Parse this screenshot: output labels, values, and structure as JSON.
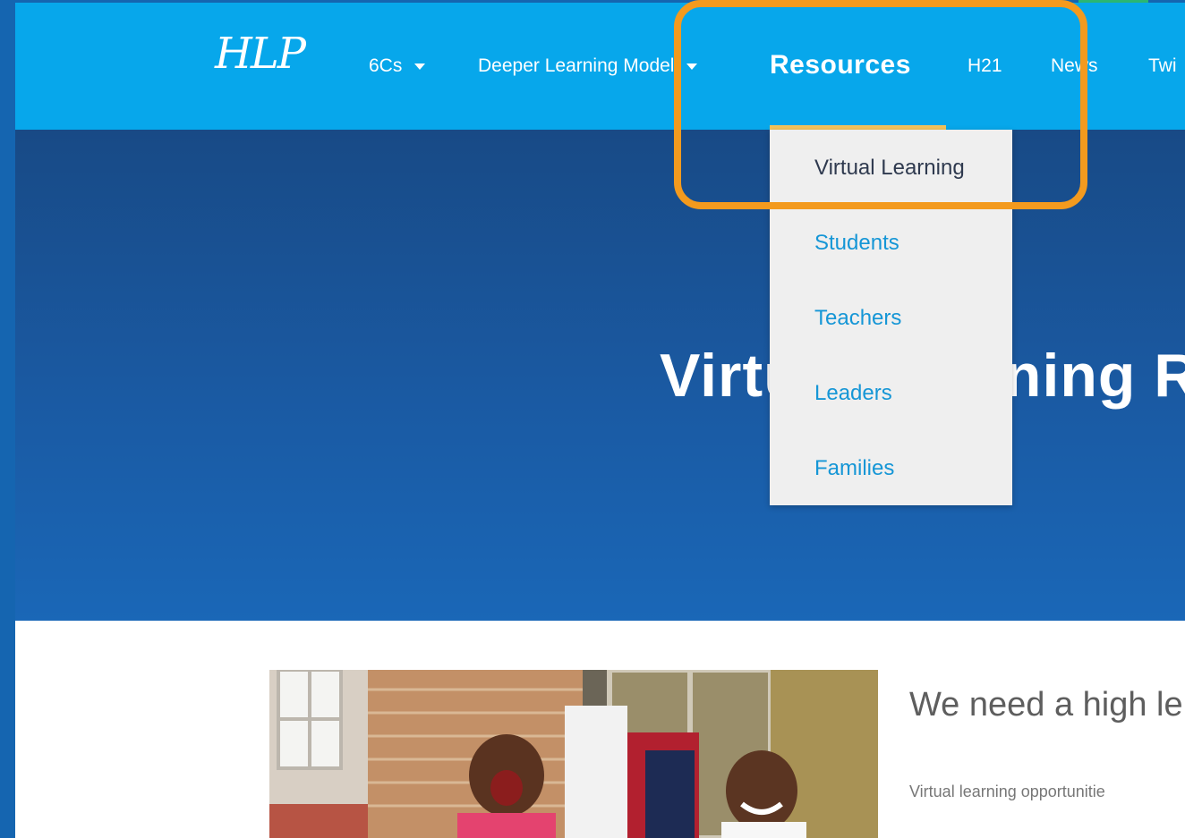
{
  "logo": {
    "text": "HLP"
  },
  "nav": {
    "items": [
      {
        "label": "6Cs",
        "has_dropdown": true
      },
      {
        "label": "Deeper Learning Model",
        "has_dropdown": true
      },
      {
        "label": "Resources",
        "has_dropdown": true,
        "active": true
      },
      {
        "label": "H21"
      },
      {
        "label": "News"
      },
      {
        "label": "Twi"
      }
    ],
    "active_color": "#f4c35a"
  },
  "dropdown": {
    "items": [
      {
        "label": "Virtual Learning",
        "current": true
      },
      {
        "label": "Students"
      },
      {
        "label": "Teachers"
      },
      {
        "label": "Leaders"
      },
      {
        "label": "Families"
      }
    ]
  },
  "hero": {
    "title": "Virtual Learning R"
  },
  "content": {
    "headline": "We need a high le",
    "body": "Virtual learning opportunitie"
  },
  "colors": {
    "navbar": "#07a7eb",
    "hero": "#1a5aa3",
    "highlight": "#f39a1e"
  }
}
